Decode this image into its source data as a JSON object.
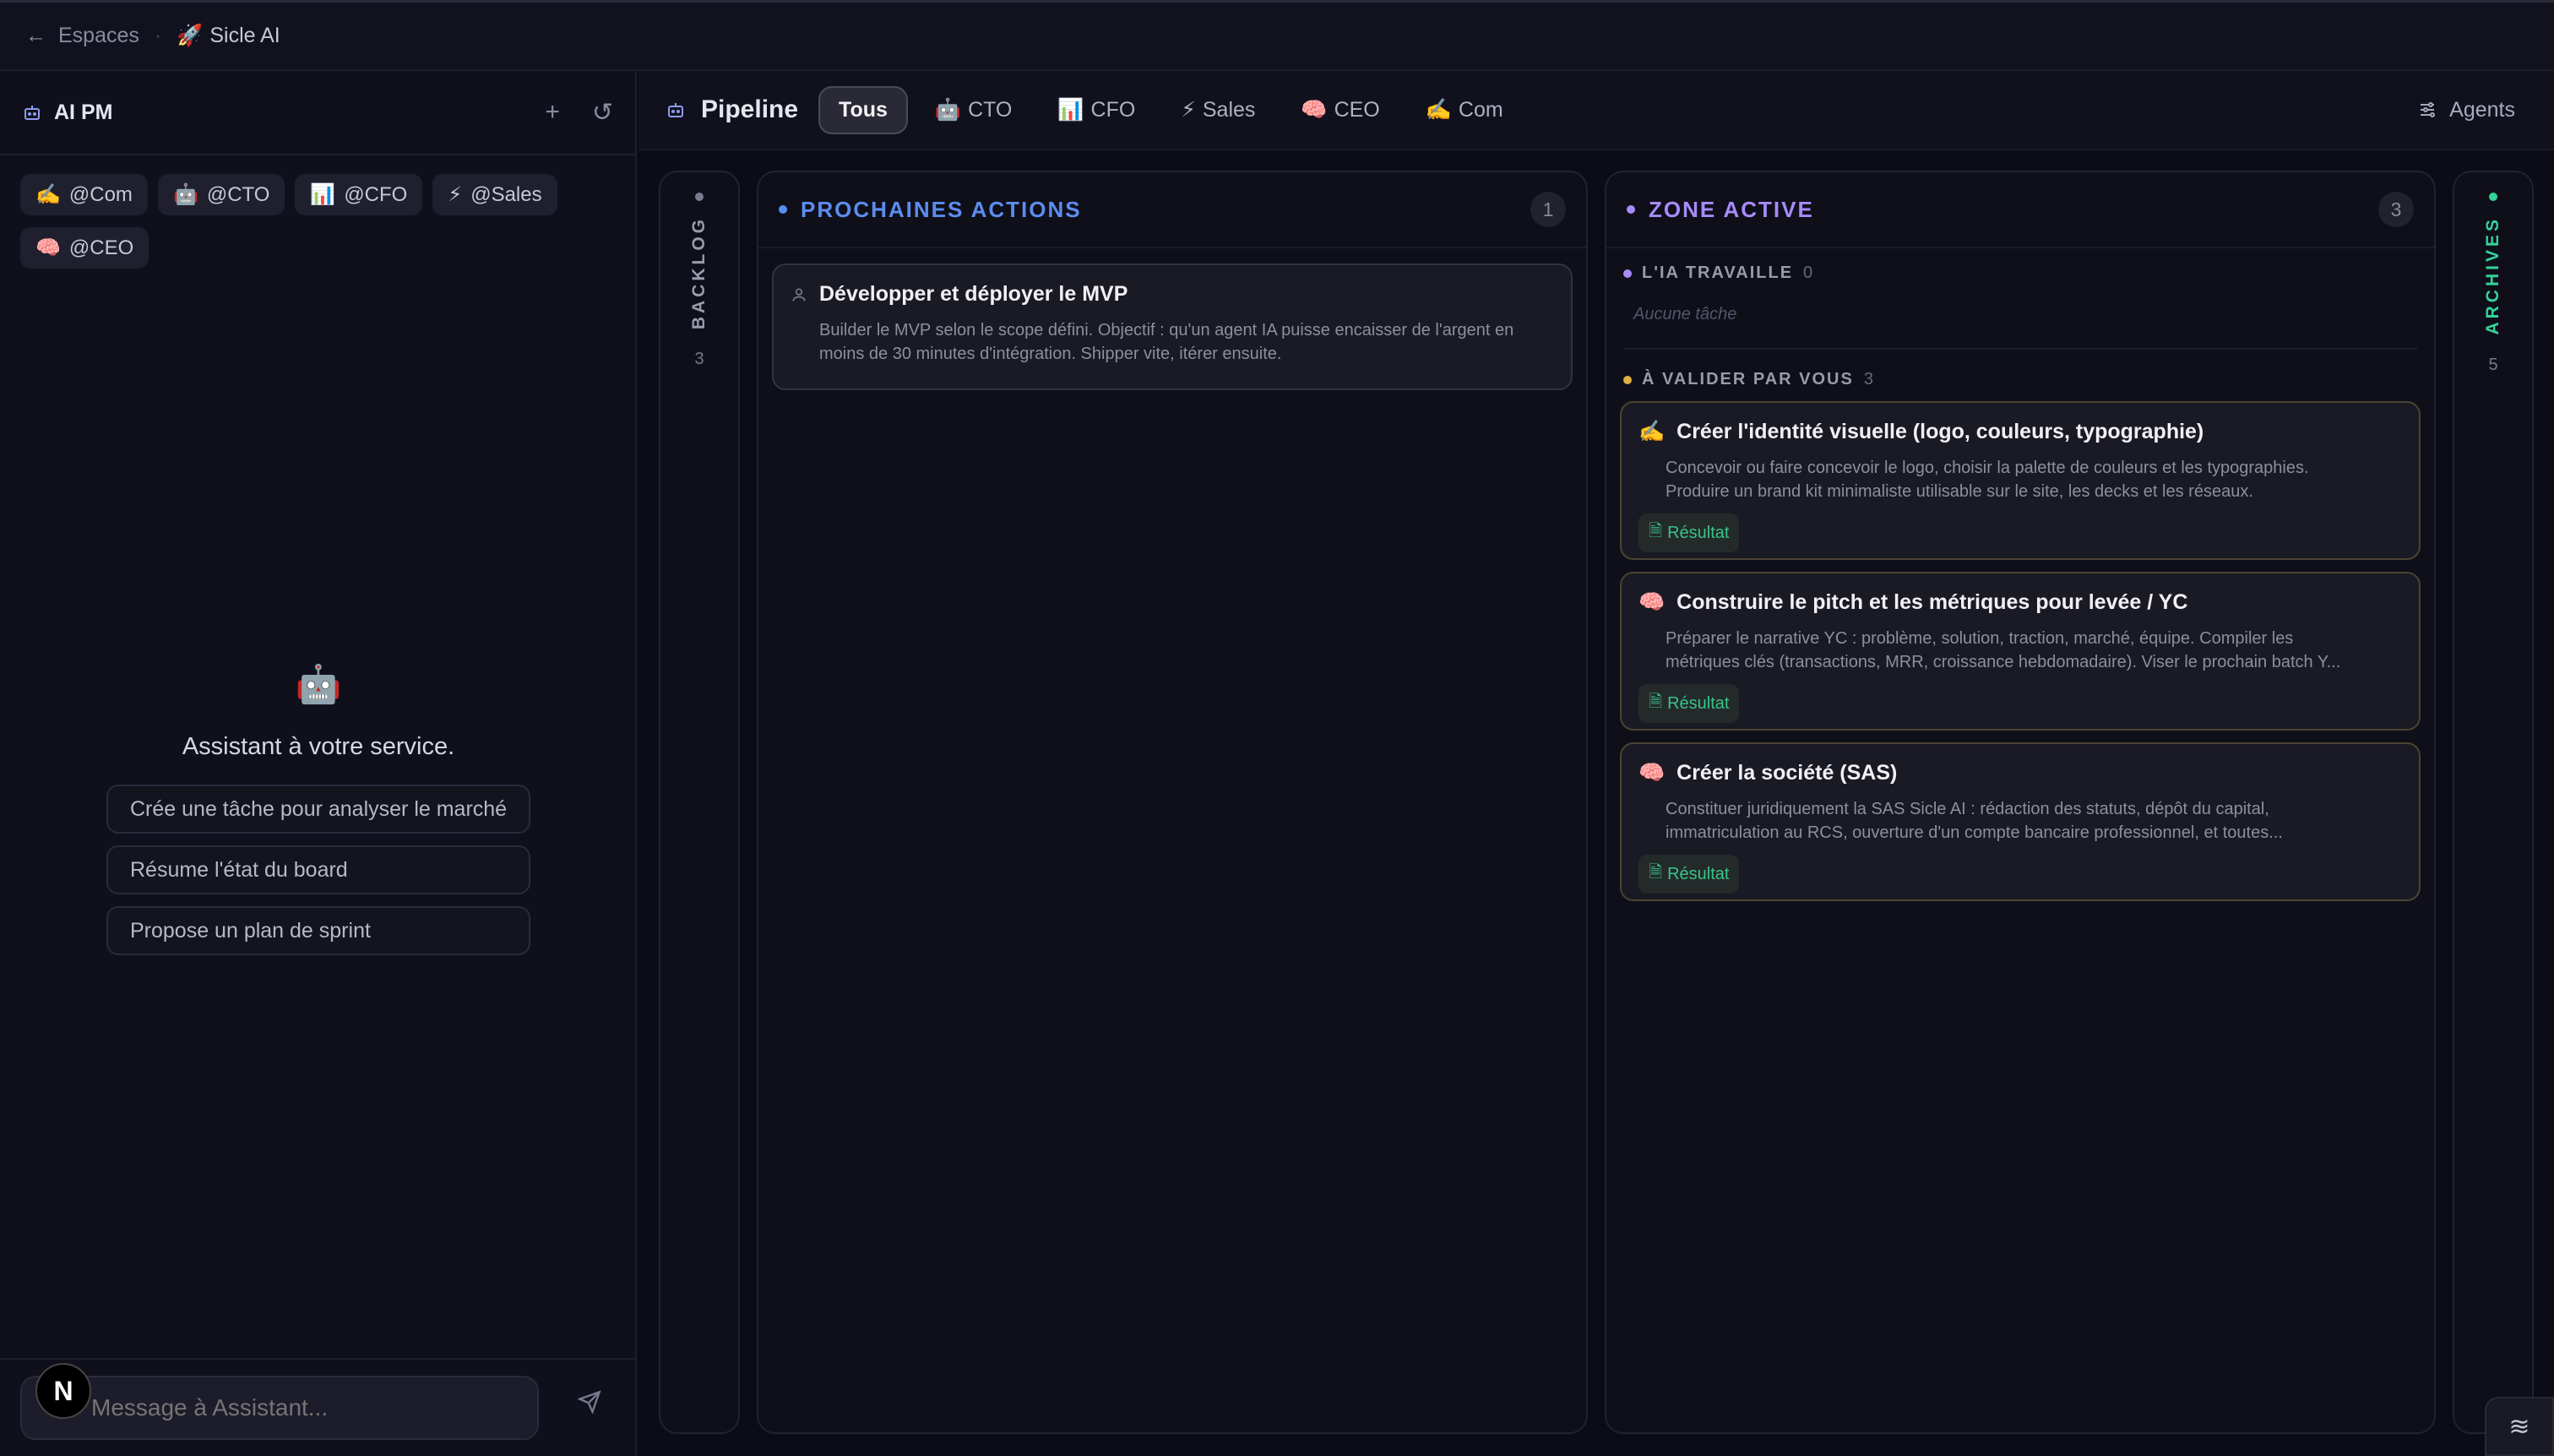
{
  "topbar": {
    "back_label": "Espaces",
    "separator": "·",
    "space_icon": "🚀",
    "space_name": "Sicle AI"
  },
  "left_panel": {
    "title": "AI PM",
    "chips": [
      {
        "icon": "✍️",
        "label": "@Com"
      },
      {
        "icon": "🤖",
        "label": "@CTO"
      },
      {
        "icon": "📊",
        "label": "@CFO"
      },
      {
        "icon": "⚡",
        "label": "@Sales"
      },
      {
        "icon": "🧠",
        "label": "@CEO"
      }
    ],
    "assistant_icon": "🤖",
    "assistant_title": "Assistant à votre service.",
    "suggestions": [
      "Crée une tâche pour analyser le marché",
      "Résume l'état du board",
      "Propose un plan de sprint"
    ],
    "composer_placeholder": "Message à Assistant...",
    "badge_letter": "N"
  },
  "pipeline": {
    "title": "Pipeline",
    "tabs": [
      {
        "icon": "",
        "label": "Tous",
        "active": true
      },
      {
        "icon": "🤖",
        "label": "CTO"
      },
      {
        "icon": "📊",
        "label": "CFO"
      },
      {
        "icon": "⚡",
        "label": "Sales"
      },
      {
        "icon": "🧠",
        "label": "CEO"
      },
      {
        "icon": "✍️",
        "label": "Com"
      }
    ],
    "agents_label": "Agents"
  },
  "board": {
    "backlog": {
      "label": "BACKLOG",
      "count": "3"
    },
    "next_actions": {
      "title": "PROCHAINES ACTIONS",
      "count": "1",
      "cards": [
        {
          "title": "Développer et déployer le MVP",
          "desc": "Builder le MVP selon le scope défini. Objectif : qu'un agent IA puisse encaisser de l'argent en moins de 30 minutes d'intégration. Shipper vite, itérer ensuite."
        }
      ]
    },
    "active_zone": {
      "title": "ZONE ACTIVE",
      "count": "3",
      "ai_working": {
        "label": "L'IA TRAVAILLE",
        "count": "0",
        "empty": "Aucune tâche"
      },
      "to_validate": {
        "label": "À VALIDER PAR VOUS",
        "count": "3"
      },
      "cards": [
        {
          "icon": "✍️",
          "title": "Créer l'identité visuelle (logo, couleurs, typographie)",
          "desc1": "Concevoir ou faire concevoir le logo, choisir la palette de couleurs et les typographies.",
          "desc2": "Produire un brand kit minimaliste utilisable sur le site, les decks et les réseaux.",
          "result": "Résultat"
        },
        {
          "icon": "🧠",
          "title": "Construire le pitch et les métriques pour levée / YC",
          "desc1": "Préparer le narrative YC : problème, solution, traction, marché, équipe. Compiler les",
          "desc2": "métriques clés (transactions, MRR, croissance hebdomadaire). Viser le prochain batch Y...",
          "result": "Résultat"
        },
        {
          "icon": "🧠",
          "title": "Créer la société (SAS)",
          "desc1": "Constituer juridiquement la SAS Sicle AI : rédaction des statuts, dépôt du capital,",
          "desc2": "immatriculation au RCS, ouverture d'un compte bancaire professionnel, et toutes...",
          "result": "Résultat"
        }
      ]
    },
    "archives": {
      "label": "ARCHIVES",
      "count": "5"
    }
  },
  "colors": {
    "background": "#0c0c18",
    "blue_accent": "#5b8def",
    "purple_accent": "#a78bfa",
    "green_accent": "#34d399",
    "amber_accent": "#e0b040",
    "result_green": "#38c48a"
  }
}
